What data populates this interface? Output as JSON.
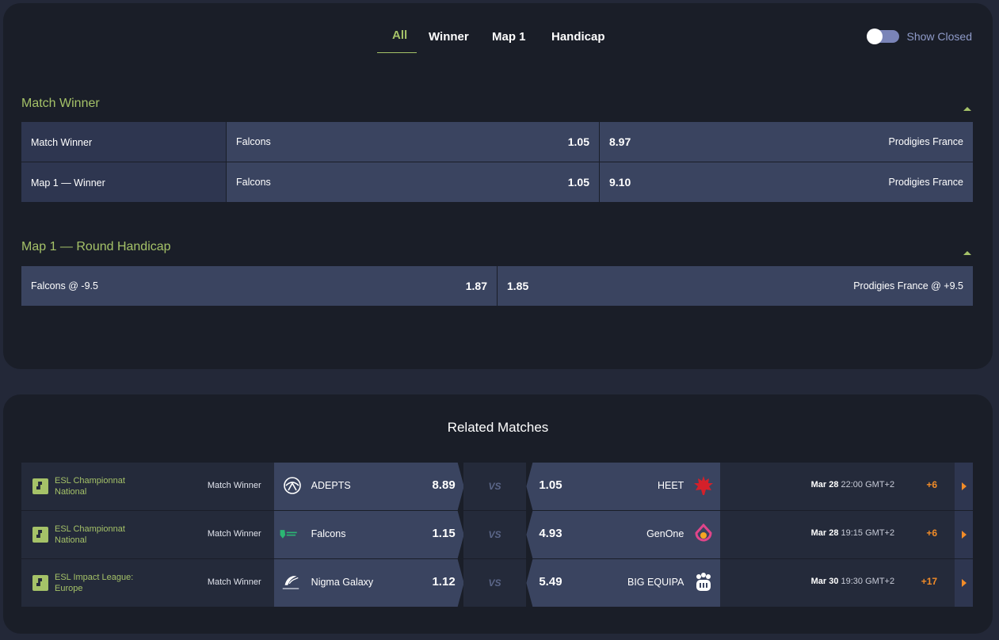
{
  "tabs": [
    "All",
    "Winner",
    "Map 1",
    "Handicap"
  ],
  "active_tab": "All",
  "show_closed": {
    "label": "Show Closed",
    "enabled": false
  },
  "sections": [
    {
      "title": "Match Winner",
      "rows": [
        {
          "label": "Match Winner",
          "home": "Falcons",
          "home_odd": "1.05",
          "away_odd": "8.97",
          "away": "Prodigies France"
        },
        {
          "label": "Map 1 — Winner",
          "home": "Falcons",
          "home_odd": "1.05",
          "away_odd": "9.10",
          "away": "Prodigies France"
        }
      ]
    },
    {
      "title": "Map 1 — Round Handicap",
      "rows": [
        {
          "home": "Falcons @ -9.5",
          "home_odd": "1.87",
          "away_odd": "1.85",
          "away": "Prodigies France @ +9.5"
        }
      ]
    }
  ],
  "related": {
    "title": "Related Matches",
    "vs_label": "VS",
    "matches": [
      {
        "league": "ESL Championnat National",
        "market": "Match Winner",
        "home": "ADEPTS",
        "home_odd": "8.89",
        "away_odd": "1.05",
        "away": "HEET",
        "date": "Mar 28",
        "time": "22:00 GMT+2",
        "more": "+6",
        "home_logo": "adepts-logo",
        "away_logo": "heet-logo"
      },
      {
        "league": "ESL Championnat National",
        "market": "Match Winner",
        "home": "Falcons",
        "home_odd": "1.15",
        "away_odd": "4.93",
        "away": "GenOne",
        "date": "Mar 28",
        "time": "19:15 GMT+2",
        "more": "+6",
        "home_logo": "falcons-logo",
        "away_logo": "genone-logo"
      },
      {
        "league": "ESL Impact League: Europe",
        "market": "Match Winner",
        "home": "Nigma Galaxy",
        "home_odd": "1.12",
        "away_odd": "5.49",
        "away": "BIG EQUIPA",
        "date": "Mar 30",
        "time": "19:30 GMT+2",
        "more": "+17",
        "home_logo": "nigma-galaxy-logo",
        "away_logo": "big-equipa-logo"
      }
    ]
  },
  "colors": {
    "accent": "#a5c268",
    "odds_bg": "#3a4460",
    "panel_bg": "#1a1e28",
    "orange": "#f28c28"
  }
}
